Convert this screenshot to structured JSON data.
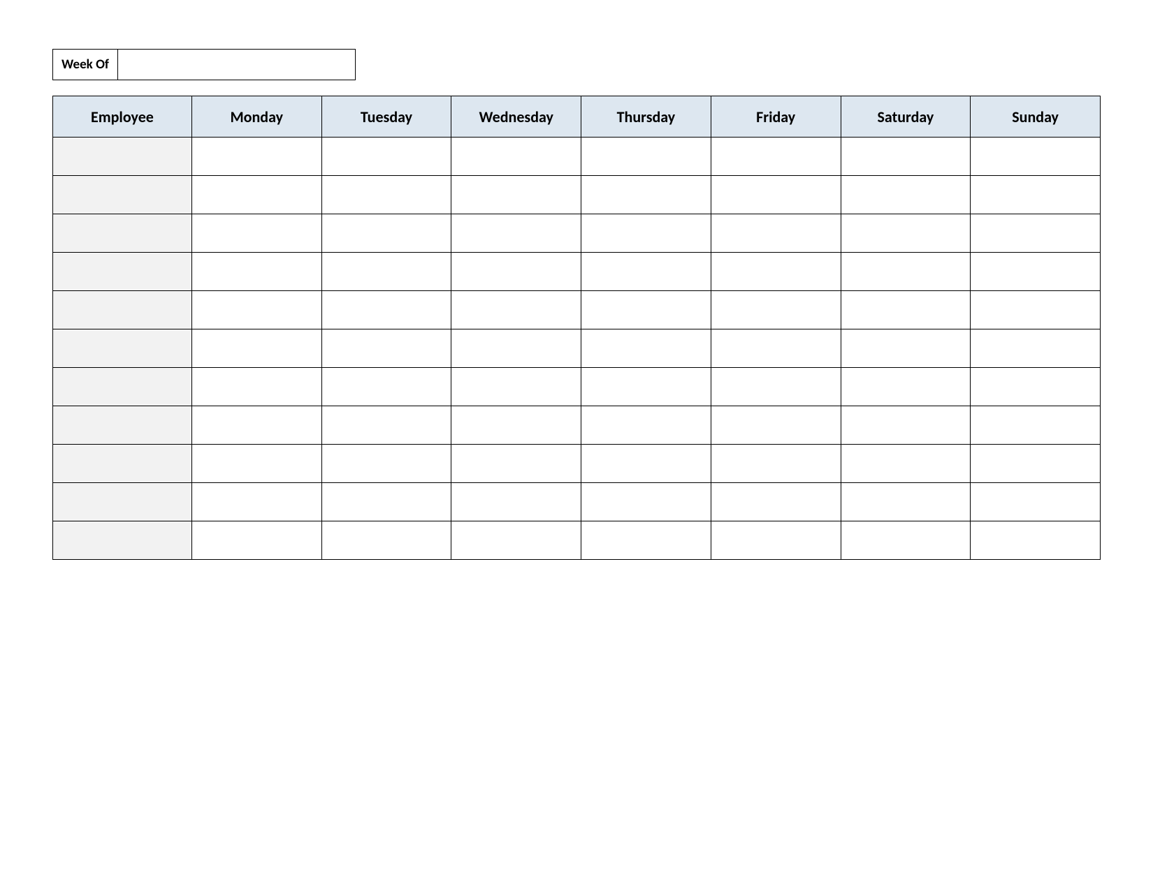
{
  "week_of_label": "Week Of",
  "week_of_value": "",
  "columns": [
    "Employee",
    "Monday",
    "Tuesday",
    "Wednesday",
    "Thursday",
    "Friday",
    "Saturday",
    "Sunday"
  ],
  "rows": [
    {
      "employee": "",
      "cells": [
        "",
        "",
        "",
        "",
        "",
        "",
        ""
      ]
    },
    {
      "employee": "",
      "cells": [
        "",
        "",
        "",
        "",
        "",
        "",
        ""
      ]
    },
    {
      "employee": "",
      "cells": [
        "",
        "",
        "",
        "",
        "",
        "",
        ""
      ]
    },
    {
      "employee": "",
      "cells": [
        "",
        "",
        "",
        "",
        "",
        "",
        ""
      ]
    },
    {
      "employee": "",
      "cells": [
        "",
        "",
        "",
        "",
        "",
        "",
        ""
      ]
    },
    {
      "employee": "",
      "cells": [
        "",
        "",
        "",
        "",
        "",
        "",
        ""
      ]
    },
    {
      "employee": "",
      "cells": [
        "",
        "",
        "",
        "",
        "",
        "",
        ""
      ]
    },
    {
      "employee": "",
      "cells": [
        "",
        "",
        "",
        "",
        "",
        "",
        ""
      ]
    },
    {
      "employee": "",
      "cells": [
        "",
        "",
        "",
        "",
        "",
        "",
        ""
      ]
    },
    {
      "employee": "",
      "cells": [
        "",
        "",
        "",
        "",
        "",
        "",
        ""
      ]
    },
    {
      "employee": "",
      "cells": [
        "",
        "",
        "",
        "",
        "",
        "",
        ""
      ]
    }
  ]
}
